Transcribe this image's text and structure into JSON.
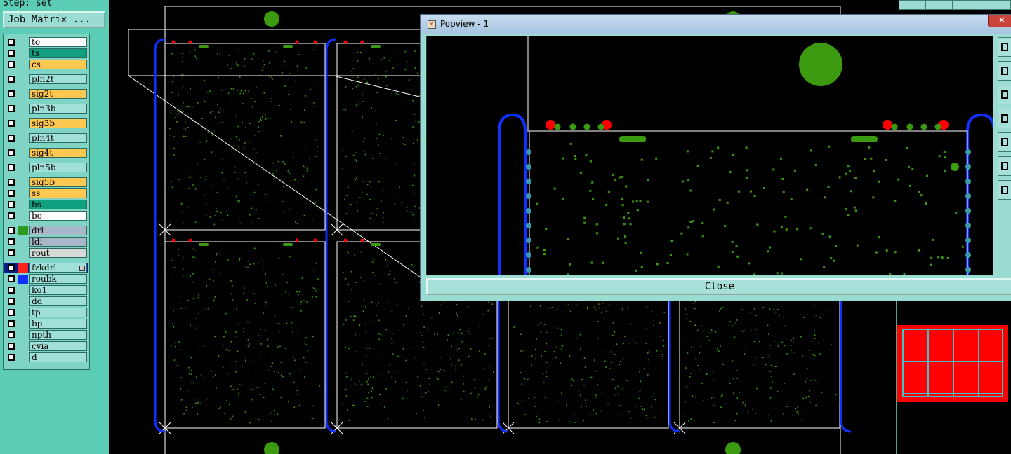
{
  "app": {
    "step_label": "Step: set",
    "job_matrix_label": "Job Matrix ..."
  },
  "layers": [
    {
      "name": "to",
      "color": "#ffffff",
      "swatch": ""
    },
    {
      "name": "ts",
      "color": "#10a080",
      "swatch": ""
    },
    {
      "name": "cs",
      "color": "#ffc850",
      "swatch": ""
    },
    {
      "name": "pln2t",
      "color": "#a0e0d8",
      "swatch": ""
    },
    {
      "name": "sig2t",
      "color": "#ffc850",
      "swatch": ""
    },
    {
      "name": "pln3b",
      "color": "#a0e0d8",
      "swatch": ""
    },
    {
      "name": "sig3b",
      "color": "#ffc850",
      "swatch": ""
    },
    {
      "name": "pln4t",
      "color": "#a0e0d8",
      "swatch": ""
    },
    {
      "name": "sig4t",
      "color": "#ffc850",
      "swatch": ""
    },
    {
      "name": "pln5b",
      "color": "#a0e0d8",
      "swatch": ""
    },
    {
      "name": "sig5b",
      "color": "#ffc850",
      "swatch": ""
    },
    {
      "name": "ss",
      "color": "#ffc850",
      "swatch": ""
    },
    {
      "name": "bs",
      "color": "#10a080",
      "swatch": ""
    },
    {
      "name": "bo",
      "color": "#ffffff",
      "swatch": ""
    },
    {
      "name": "drl",
      "color": "#a8b8c8",
      "swatch": "#2e9a20"
    },
    {
      "name": "ldi",
      "color": "#a8b8c8",
      "swatch": ""
    },
    {
      "name": "rout",
      "color": "#d8d8d8",
      "swatch": ""
    },
    {
      "name": "fzkdrl",
      "color": "#a0e0d8",
      "swatch": "#ff2020",
      "active": true
    },
    {
      "name": "roubk",
      "color": "#a0e0d8",
      "swatch": "#1030ff"
    },
    {
      "name": "ko1",
      "color": "#a0e0d8",
      "swatch": ""
    },
    {
      "name": "dd",
      "color": "#a0e0d8",
      "swatch": ""
    },
    {
      "name": "tp",
      "color": "#a0e0d8",
      "swatch": ""
    },
    {
      "name": "bp",
      "color": "#a0e0d8",
      "swatch": ""
    },
    {
      "name": "npth",
      "color": "#a0e0d8",
      "swatch": ""
    },
    {
      "name": "cvia",
      "color": "#a0e0d8",
      "swatch": ""
    },
    {
      "name": "d",
      "color": "#a0e0d8",
      "swatch": ""
    }
  ],
  "popview": {
    "title": "Popview - 1",
    "close_label": "Close",
    "close_x": "✕"
  },
  "colors": {
    "panel_bg": "#5acdb4",
    "board_outline": "#ffffff",
    "pad_green": "#3c9a10",
    "route_blue": "#1030ff",
    "fiducial_red": "#ff0000"
  }
}
